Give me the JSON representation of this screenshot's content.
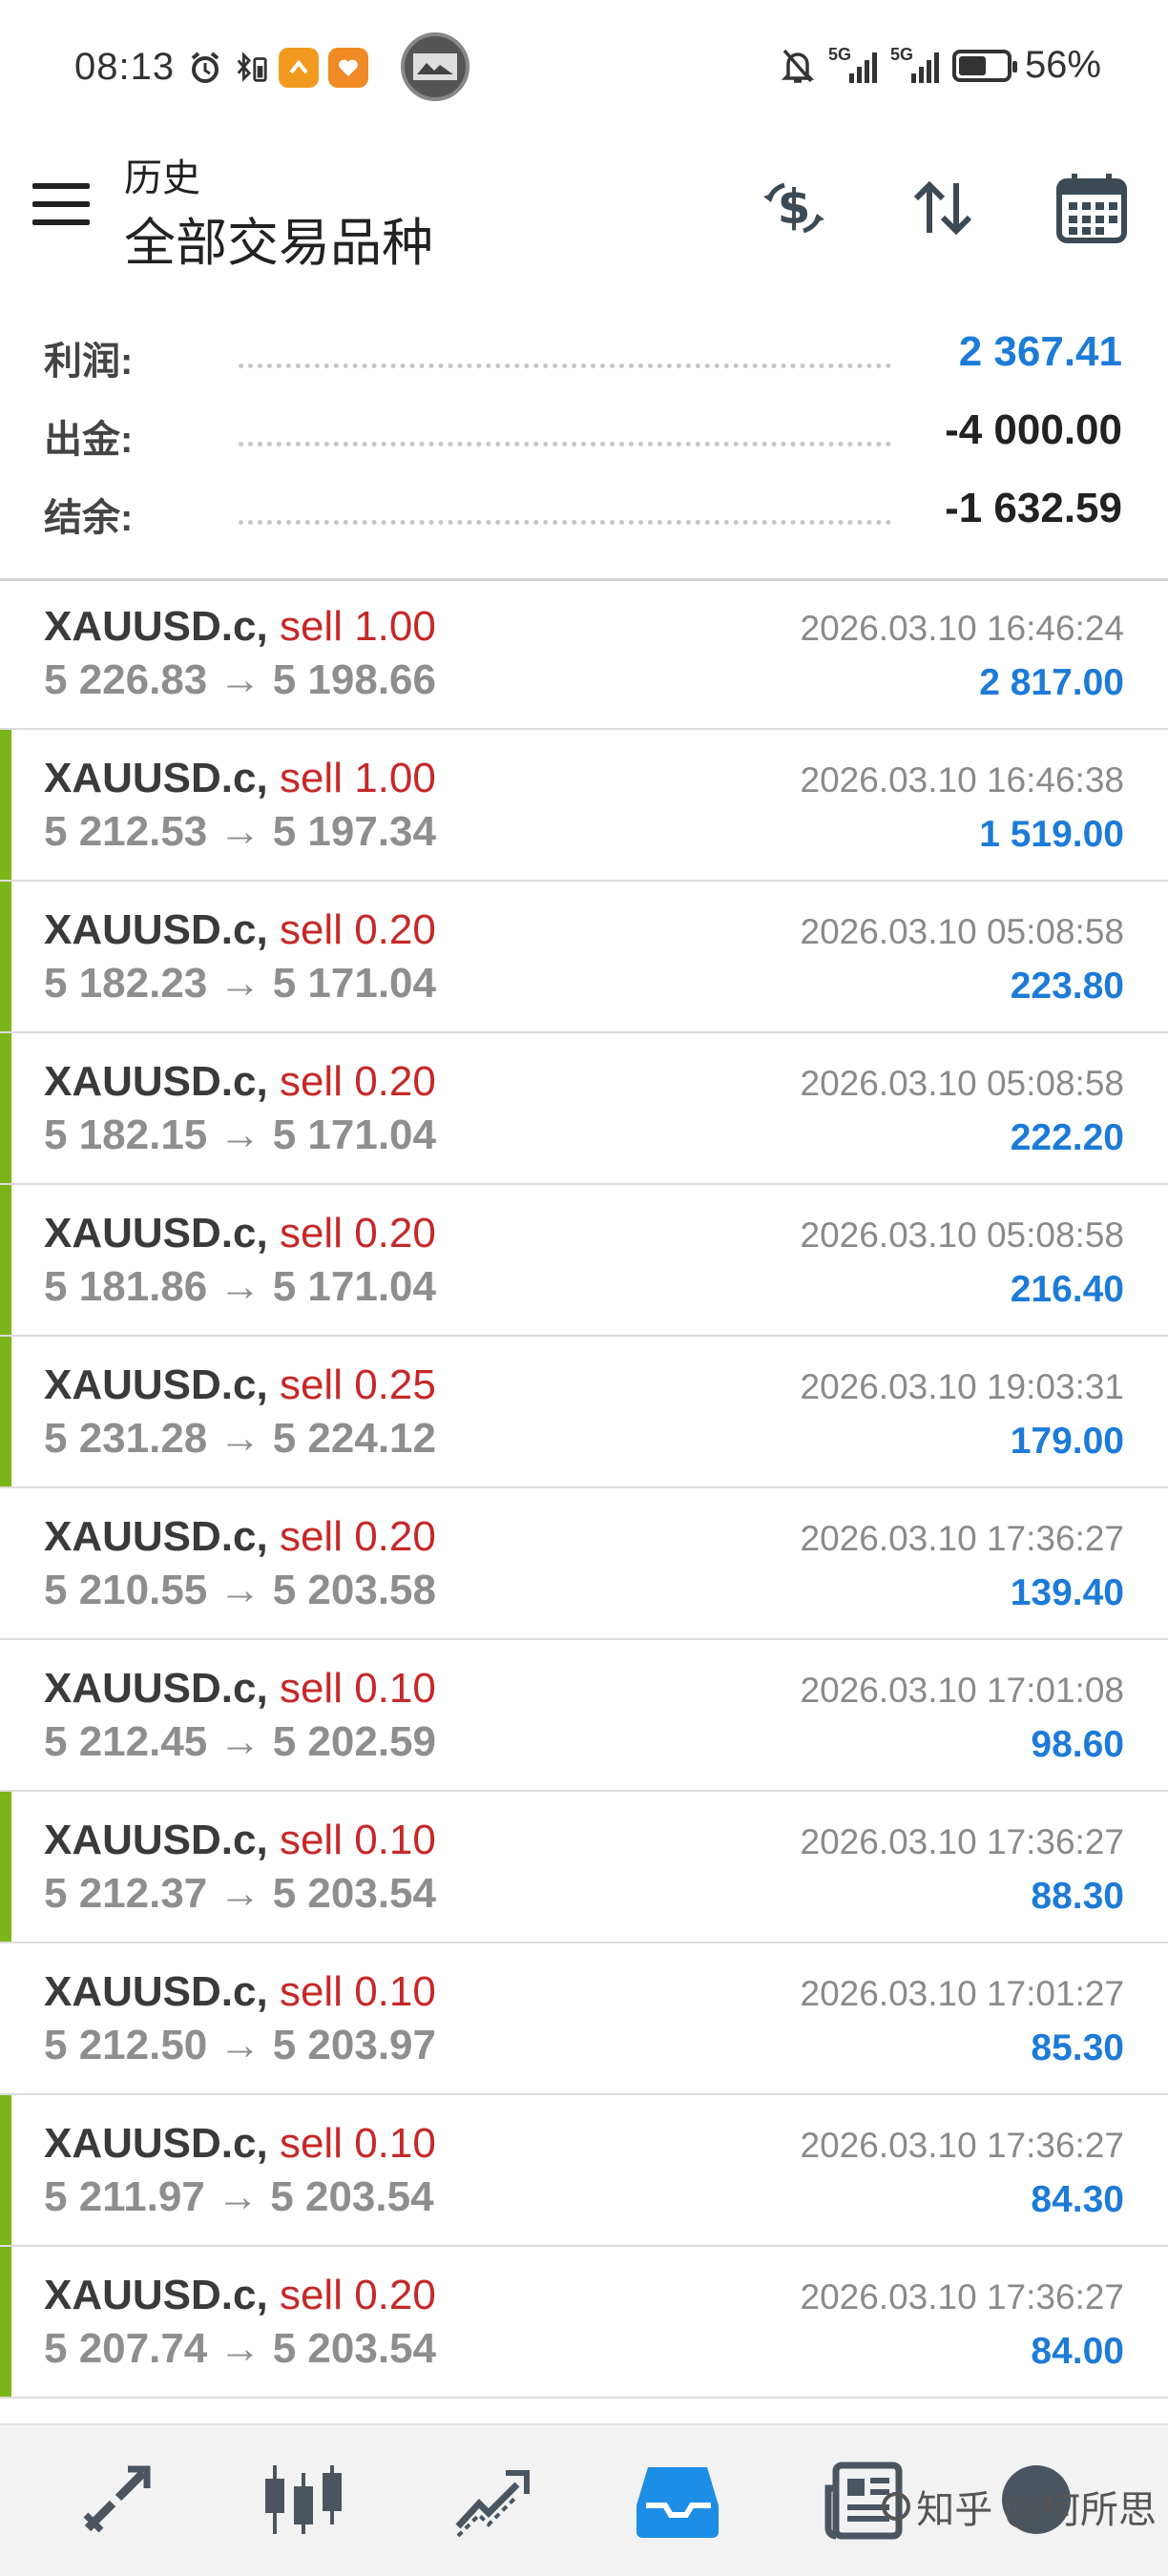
{
  "status_bar": {
    "time": "08:13",
    "battery": "56%",
    "battery_level": 0.56,
    "network_labels": [
      "5G",
      "5G"
    ]
  },
  "header": {
    "subtitle": "历史",
    "title": "全部交易品种",
    "icons": [
      "menu-icon",
      "currency-exchange-icon",
      "sort-icon",
      "calendar-icon"
    ]
  },
  "summary": {
    "profit_label": "利润:",
    "profit_value": "2 367.41",
    "withdrawal_label": "出金:",
    "withdrawal_value": "-4 000.00",
    "balance_label": "结余:",
    "balance_value": "-1 632.59"
  },
  "trades": [
    {
      "symbol": "XAUUSD.c,",
      "side": "sell 1.00",
      "prices": "5 226.83 → 5 198.66",
      "time": "2026.03.10 16:46:24",
      "profit": "2 817.00",
      "marked": false
    },
    {
      "symbol": "XAUUSD.c,",
      "side": "sell 1.00",
      "prices": "5 212.53 → 5 197.34",
      "time": "2026.03.10 16:46:38",
      "profit": "1 519.00",
      "marked": true
    },
    {
      "symbol": "XAUUSD.c,",
      "side": "sell 0.20",
      "prices": "5 182.23 → 5 171.04",
      "time": "2026.03.10 05:08:58",
      "profit": "223.80",
      "marked": true
    },
    {
      "symbol": "XAUUSD.c,",
      "side": "sell 0.20",
      "prices": "5 182.15 → 5 171.04",
      "time": "2026.03.10 05:08:58",
      "profit": "222.20",
      "marked": true
    },
    {
      "symbol": "XAUUSD.c,",
      "side": "sell 0.20",
      "prices": "5 181.86 → 5 171.04",
      "time": "2026.03.10 05:08:58",
      "profit": "216.40",
      "marked": true
    },
    {
      "symbol": "XAUUSD.c,",
      "side": "sell 0.25",
      "prices": "5 231.28 → 5 224.12",
      "time": "2026.03.10 19:03:31",
      "profit": "179.00",
      "marked": true
    },
    {
      "symbol": "XAUUSD.c,",
      "side": "sell 0.20",
      "prices": "5 210.55 → 5 203.58",
      "time": "2026.03.10 17:36:27",
      "profit": "139.40",
      "marked": false
    },
    {
      "symbol": "XAUUSD.c,",
      "side": "sell 0.10",
      "prices": "5 212.45 → 5 202.59",
      "time": "2026.03.10 17:01:08",
      "profit": "98.60",
      "marked": false
    },
    {
      "symbol": "XAUUSD.c,",
      "side": "sell 0.10",
      "prices": "5 212.37 → 5 203.54",
      "time": "2026.03.10 17:36:27",
      "profit": "88.30",
      "marked": true
    },
    {
      "symbol": "XAUUSD.c,",
      "side": "sell 0.10",
      "prices": "5 212.50 → 5 203.97",
      "time": "2026.03.10 17:01:27",
      "profit": "85.30",
      "marked": false
    },
    {
      "symbol": "XAUUSD.c,",
      "side": "sell 0.10",
      "prices": "5 211.97 → 5 203.54",
      "time": "2026.03.10 17:36:27",
      "profit": "84.30",
      "marked": true
    },
    {
      "symbol": "XAUUSD.c,",
      "side": "sell 0.20",
      "prices": "5 207.74 → 5 203.54",
      "time": "2026.03.10 17:36:27",
      "profit": "84.00",
      "marked": true
    }
  ],
  "bottom_nav": {
    "items": [
      "quotes-icon",
      "chart-icon",
      "trade-icon",
      "history-icon",
      "news-icon",
      "settings-icon"
    ],
    "active": "history-icon",
    "watermark": "知乎 @何所思"
  },
  "colors": {
    "profit_blue": "#1d7bd8",
    "sell_red": "#c62828",
    "marker_green": "#7cb518",
    "active_nav": "#1d8ee6"
  }
}
